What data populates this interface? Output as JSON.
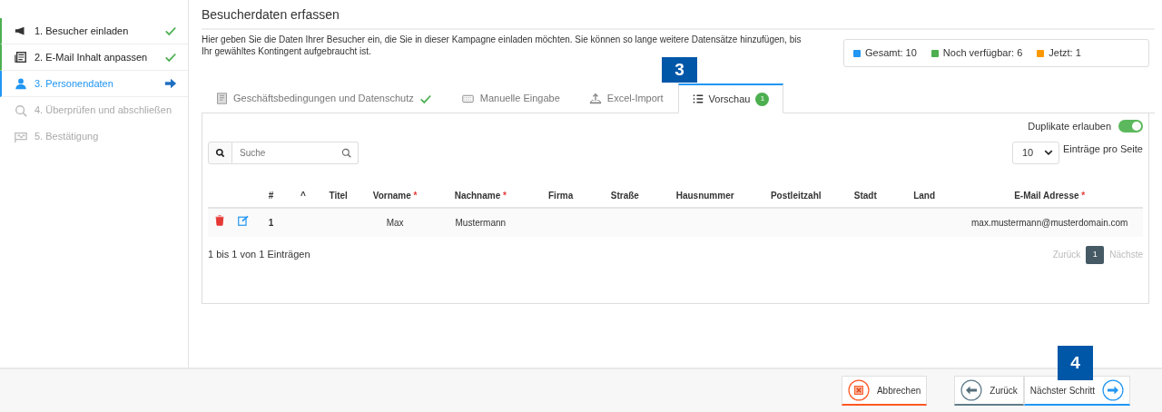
{
  "steps": [
    {
      "label": "1. Besucher einladen",
      "kind": "done"
    },
    {
      "label": "2. E-Mail Inhalt anpassen",
      "kind": "done"
    },
    {
      "label": "3. Personendaten",
      "kind": "active"
    },
    {
      "label": "4. Überprüfen und abschließen",
      "kind": "disabled"
    },
    {
      "label": "5. Bestätigung",
      "kind": "disabled"
    }
  ],
  "title": "Besucherdaten erfassen",
  "description": "Hier geben Sie die Daten Ihrer Besucher ein, die Sie in dieser Kampagne einladen möchten. Sie können so lange weitere Datensätze hinzufügen, bis Ihr gewähltes Kontingent aufgebraucht ist.",
  "legend": [
    {
      "label": "Gesamt: 10",
      "color": "#2196f3"
    },
    {
      "label": "Noch verfügbar: 6",
      "color": "#4caf50"
    },
    {
      "label": "Jetzt: 1",
      "color": "#ff9800"
    }
  ],
  "tabs": [
    {
      "label": "Geschäftsbedingungen und Datenschutz",
      "done": true,
      "selected": false
    },
    {
      "label": "Manuelle Eingabe",
      "done": false,
      "selected": false
    },
    {
      "label": "Excel-Import",
      "done": false,
      "selected": false
    },
    {
      "label": "Vorschau",
      "done": false,
      "badge": "1",
      "selected": true
    }
  ],
  "duplicates": {
    "label": "Duplikate erlauben",
    "on": true
  },
  "page_size": {
    "value": "10",
    "label": "Einträge pro Seite"
  },
  "search": {
    "placeholder": "Suche"
  },
  "table": {
    "columns": [
      {
        "label": "#"
      },
      {
        "label": "^"
      },
      {
        "label": "Titel"
      },
      {
        "label": "Vorname",
        "required_mark": "*"
      },
      {
        "label": "Nachname",
        "required_mark": "*"
      },
      {
        "label": "Firma"
      },
      {
        "label": "Straße"
      },
      {
        "label": "Hausnummer"
      },
      {
        "label": "Postleitzahl"
      },
      {
        "label": "Stadt"
      },
      {
        "label": "Land"
      },
      {
        "label": "E-Mail Adresse",
        "required_mark": "*"
      }
    ],
    "rows": [
      {
        "cells": [
          "1",
          "",
          "",
          "Max",
          "Mustermann",
          "",
          "",
          "",
          "",
          "",
          "",
          "max.mustermann@musterdomain.com"
        ]
      }
    ]
  },
  "info": "1 bis 1 von 1 Einträgen",
  "pagination": {
    "prev": "Zurück",
    "pages": [
      {
        "label": "1",
        "selected": true
      }
    ],
    "next": "Nächste"
  },
  "buttons": [
    {
      "label": "Abbrechen",
      "kind": "cancel"
    },
    {
      "label": "Zurück",
      "kind": "back"
    },
    {
      "label": "Nächster Schritt",
      "kind": "next"
    }
  ],
  "callouts": [
    {
      "label": "3"
    },
    {
      "label": "4"
    }
  ]
}
